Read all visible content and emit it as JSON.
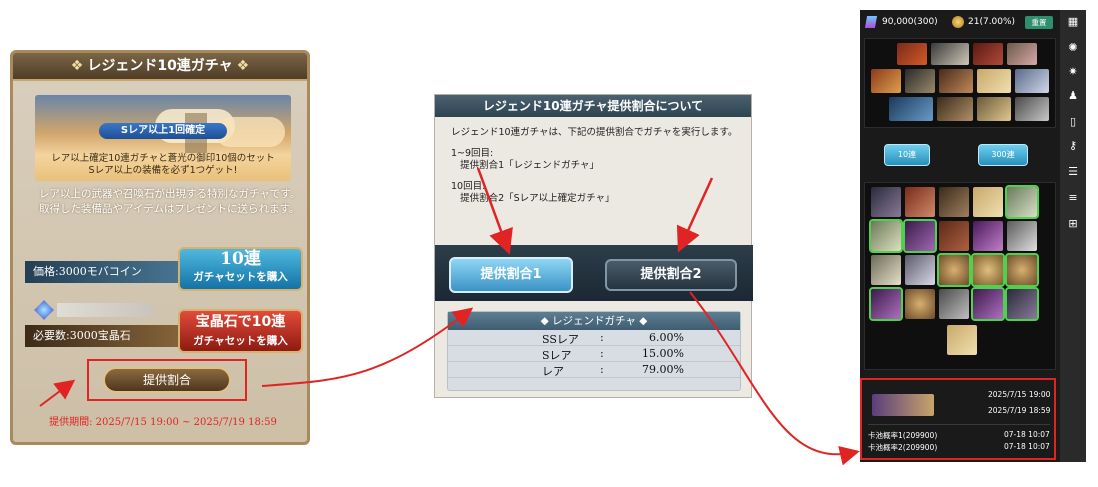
{
  "gacha": {
    "banner_title": "レジェンド10連ガチャ",
    "ribbon": "Sレア以上1回確定",
    "hero_line1": "レア以上確定10連ガチャと蒼光の御印10個のセット",
    "hero_line2": "Sレア以上の装備を必ず1つゲット!",
    "desc_line1": "レア以上の武器や召喚石が出現する特別なガチャです。",
    "desc_line2": "取得した装備品やアイテムはプレゼントに送られます。",
    "price_label": "価格:3000モバコイン",
    "buy10_big": "10連",
    "buy10_small": "ガチャセットを購入",
    "required_label": "必要数:3000宝晶石",
    "buy_gem_big": "宝晶石で10連",
    "buy_gem_small": "ガチャセットを購入",
    "rates_button": "提供割合",
    "period": "提供期間: 2025/7/15 19:00 ~ 2025/7/19 18:59"
  },
  "rates_dialog": {
    "title": "レジェンド10連ガチャ提供割合について",
    "intro": "レジェンド10連ガチャは、下記の提供割合でガチャを実行します。",
    "block1_head": "1~9回目:",
    "block1_body": "提供割合1「レジェンドガチャ」",
    "block2_head": "10回目:",
    "block2_body": "提供割合2「Sレア以上確定ガチャ」",
    "tab1": "提供割合1",
    "tab2": "提供割合2",
    "table_title": "レジェンドガチャ",
    "rows": [
      {
        "name": "SSレア",
        "colon": ":",
        "value": "6.00%"
      },
      {
        "name": "Sレア",
        "colon": ":",
        "value": "15.00%"
      },
      {
        "name": "レア",
        "colon": ":",
        "value": "79.00%"
      }
    ]
  },
  "app": {
    "gems": "90,000(300)",
    "coins": "21(7.00%)",
    "reset": "重置",
    "btn_10": "10連",
    "btn_300": "300連",
    "log_time1": "2025/7/15 19:00",
    "log_time2": "2025/7/19 18:59",
    "log_line1": "卡池概率1(209900)",
    "log_line2": "卡池概率2(209900)",
    "log_date1": "07-18 10:07",
    "log_date2": "07-18 10:07"
  }
}
